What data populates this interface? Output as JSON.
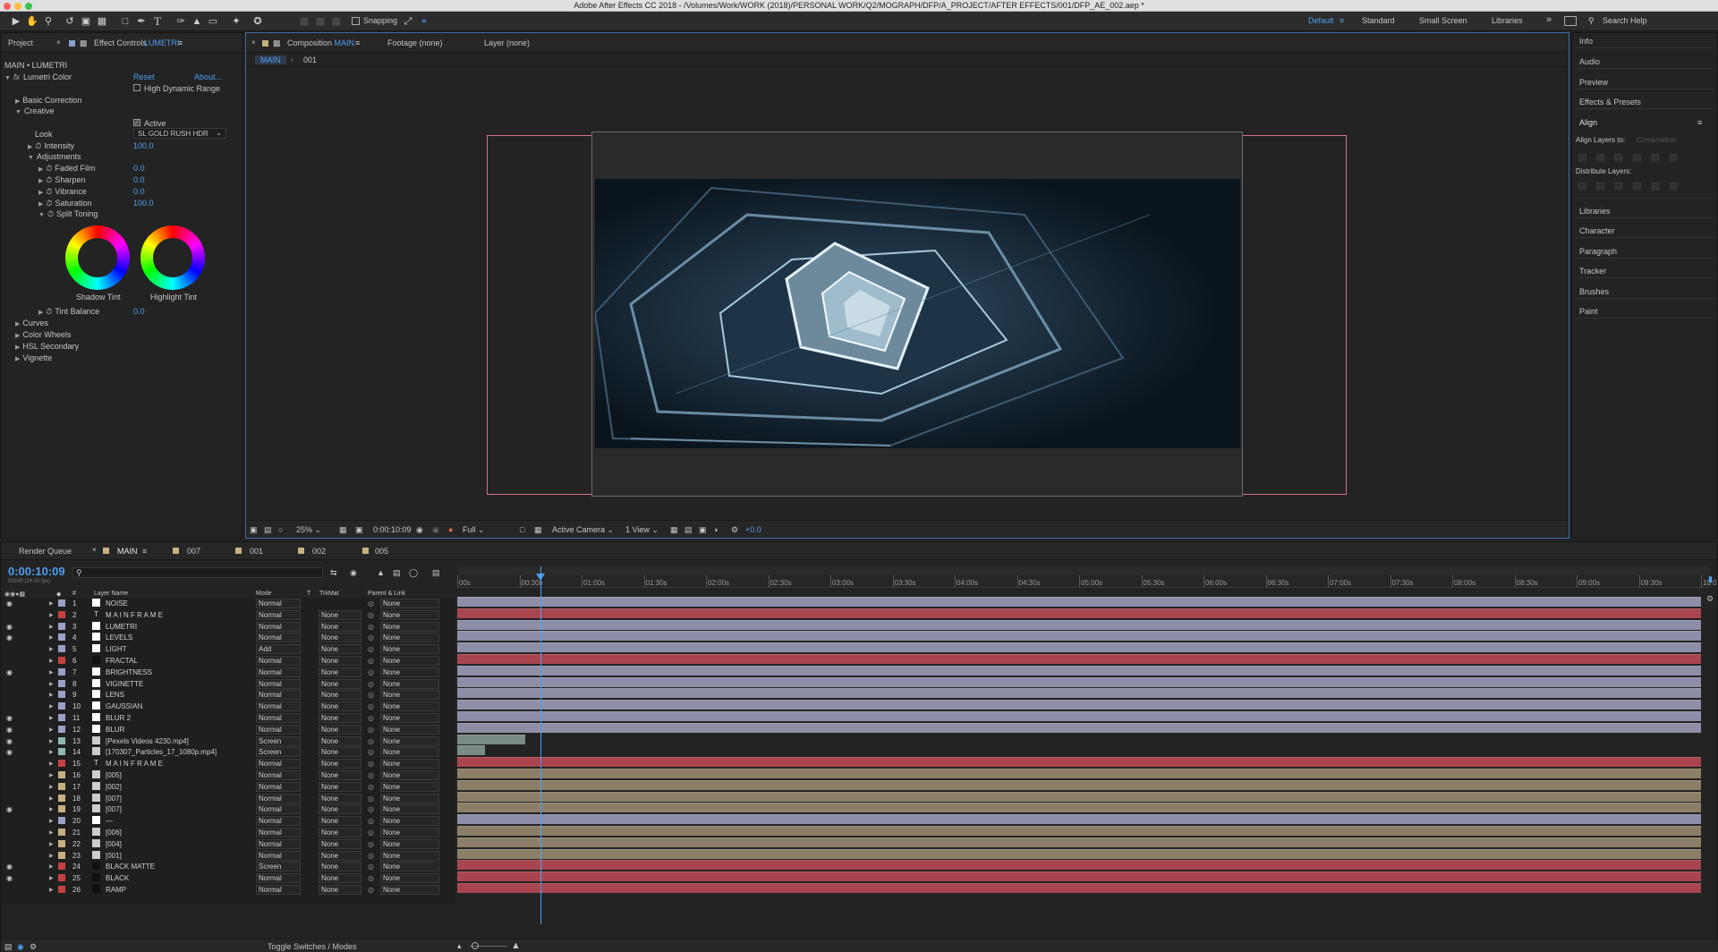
{
  "window": {
    "title": "Adobe After Effects CC 2018 - /Volumes/Work/WORK (2018)/PERSONAL WORK/Q2/MOGRAPH/DFP/A_PROJECT/AFTER EFFECTS/001/DFP_AE_002.aep *"
  },
  "toolbar": {
    "snapping": "Snapping",
    "workspaces": [
      "Default",
      "Standard",
      "Small Screen",
      "Libraries"
    ],
    "active_workspace": "Default",
    "search": "Search Help"
  },
  "left_panel": {
    "tabs": {
      "project": "Project",
      "effect_controls": "Effect Controls",
      "effect_layer": "LUMETRI"
    },
    "breadcrumb": "MAIN • LUMETRI",
    "effect": {
      "prefix": "fx",
      "name": "Lumetri Color",
      "reset": "Reset",
      "about": "About..."
    },
    "hdr": "High Dynamic Range",
    "basic": "Basic Correction",
    "creative": "Creative",
    "active": "Active",
    "look_label": "Look",
    "look_value": "SL GOLD RUSH HDR",
    "intensity": {
      "label": "Intensity",
      "value": "100.0"
    },
    "adjustments": "Adjustments",
    "params": [
      {
        "label": "Faded Film",
        "value": "0.0"
      },
      {
        "label": "Sharpen",
        "value": "0.0"
      },
      {
        "label": "Vibrance",
        "value": "0.0"
      },
      {
        "label": "Saturation",
        "value": "100.0"
      }
    ],
    "split_toning": "Split Toning",
    "shadow_tint": "Shadow Tint",
    "highlight_tint": "Highlight Tint",
    "tint_balance": {
      "label": "Tint Balance",
      "value": "0.0"
    },
    "sections": [
      "Curves",
      "Color Wheels",
      "HSL Secondary",
      "Vignette"
    ]
  },
  "viewer": {
    "tabs": {
      "composition_label": "Composition",
      "composition_name": "MAIN",
      "footage": "Footage (none)",
      "layer": "Layer (none)"
    },
    "breadcrumb": [
      "MAIN",
      "001"
    ],
    "bottom": {
      "zoom": "25%",
      "timecode": "0:00:10:09",
      "resolution": "Full",
      "camera": "Active Camera",
      "views": "1 View",
      "exposure": "+0.0"
    }
  },
  "right_panel": {
    "items": [
      "Info",
      "Audio",
      "Preview",
      "Effects & Presets",
      "Align",
      "Libraries",
      "Character",
      "Paragraph",
      "Tracker",
      "Brushes",
      "Paint"
    ],
    "align_to_label": "Align Layers to:",
    "align_to_value": "Composition",
    "distribute_label": "Distribute Layers:"
  },
  "timeline": {
    "tabs": [
      "Render Queue",
      "MAIN",
      "007",
      "001",
      "002",
      "005"
    ],
    "active_tab": "MAIN",
    "timecode": "0:00:10:09",
    "timecode_sub": "00249 (24.00 fps)",
    "columns": {
      "num": "#",
      "name": "Layer Name",
      "mode": "Mode",
      "t": "T",
      "trkmat": "TrkMat",
      "parent": "Parent & Link"
    },
    "ruler": [
      "00s",
      "00:30s",
      "01:00s",
      "01:30s",
      "02:00s",
      "02:30s",
      "03:00s",
      "03:30s",
      "04:00s",
      "04:30s",
      "05:00s",
      "05:30s",
      "06:00s",
      "06:30s",
      "07:00s",
      "07:30s",
      "08:00s",
      "08:30s",
      "09:00s",
      "09:30s",
      "10:0"
    ],
    "playhead_seconds": 0.5,
    "toggle": "Toggle Switches / Modes",
    "layers": [
      {
        "num": "1",
        "name": "NOISE",
        "mode": "Normal",
        "trkmat": "",
        "parent": "None",
        "label": "#9aa0c8",
        "bar": "#8e8ea8",
        "vis": true,
        "type": "solid",
        "start": 0,
        "end": 1
      },
      {
        "num": "2",
        "name": "M A I N F R A M E",
        "mode": "Normal",
        "trkmat": "None",
        "parent": "None",
        "label": "#c64040",
        "bar": "#a8454f",
        "vis": false,
        "type": "text",
        "start": 0,
        "end": 1
      },
      {
        "num": "3",
        "name": "LUMETRI",
        "mode": "Normal",
        "trkmat": "None",
        "parent": "None",
        "label": "#9aa0c8",
        "bar": "#8e8ea8",
        "vis": true,
        "type": "solid",
        "start": 0,
        "end": 1
      },
      {
        "num": "4",
        "name": "LEVELS",
        "mode": "Normal",
        "trkmat": "None",
        "parent": "None",
        "label": "#9aa0c8",
        "bar": "#8e8ea8",
        "vis": true,
        "type": "solid",
        "start": 0,
        "end": 1
      },
      {
        "num": "5",
        "name": "LIGHT",
        "mode": "Add",
        "trkmat": "None",
        "parent": "None",
        "label": "#9aa0c8",
        "bar": "#8e8ea8",
        "vis": false,
        "type": "solid",
        "start": 0,
        "end": 1
      },
      {
        "num": "6",
        "name": "FRACTAL",
        "mode": "Normal",
        "trkmat": "None",
        "parent": "None",
        "label": "#c64040",
        "bar": "#a8454f",
        "vis": false,
        "type": "dark",
        "start": 0,
        "end": 1
      },
      {
        "num": "7",
        "name": "BRIGHTNESS",
        "mode": "Normal",
        "trkmat": "None",
        "parent": "None",
        "label": "#9aa0c8",
        "bar": "#8e8ea8",
        "vis": true,
        "type": "solid",
        "start": 0,
        "end": 1
      },
      {
        "num": "8",
        "name": "VIGINETTE",
        "mode": "Normal",
        "trkmat": "None",
        "parent": "None",
        "label": "#9aa0c8",
        "bar": "#8e8ea8",
        "vis": false,
        "type": "solid",
        "start": 0,
        "end": 1
      },
      {
        "num": "9",
        "name": "LENS",
        "mode": "Normal",
        "trkmat": "None",
        "parent": "None",
        "label": "#9aa0c8",
        "bar": "#8e8ea8",
        "vis": false,
        "type": "solid",
        "start": 0,
        "end": 1
      },
      {
        "num": "10",
        "name": "GAUSSIAN",
        "mode": "Normal",
        "trkmat": "None",
        "parent": "None",
        "label": "#9aa0c8",
        "bar": "#8e8ea8",
        "vis": false,
        "type": "solid",
        "start": 0,
        "end": 1
      },
      {
        "num": "11",
        "name": "BLUR 2",
        "mode": "Normal",
        "trkmat": "None",
        "parent": "None",
        "label": "#9aa0c8",
        "bar": "#8e8ea8",
        "vis": true,
        "type": "solid",
        "start": 0,
        "end": 1
      },
      {
        "num": "12",
        "name": "BLUR",
        "mode": "Normal",
        "trkmat": "None",
        "parent": "None",
        "label": "#9aa0c8",
        "bar": "#8e8ea8",
        "vis": true,
        "type": "solid",
        "start": 0,
        "end": 1
      },
      {
        "num": "13",
        "name": "[Pexels Videos 4230.mp4]",
        "mode": "Screen",
        "trkmat": "None",
        "parent": "None",
        "label": "#8fb8b0",
        "bar": "#7a8a86",
        "vis": true,
        "type": "footage",
        "start": 0,
        "end": 0.055
      },
      {
        "num": "14",
        "name": "[170307_Particles_17_1080p.mp4]",
        "mode": "Screen",
        "trkmat": "None",
        "parent": "None",
        "label": "#8fb8b0",
        "bar": "#7a8a86",
        "vis": true,
        "type": "footage",
        "start": 0,
        "end": 0.022
      },
      {
        "num": "15",
        "name": "M A I N F R A M E",
        "mode": "Normal",
        "trkmat": "None",
        "parent": "None",
        "label": "#c64040",
        "bar": "#a8454f",
        "vis": false,
        "type": "text",
        "start": 0,
        "end": 1
      },
      {
        "num": "16",
        "name": "[005]",
        "mode": "Normal",
        "trkmat": "None",
        "parent": "None",
        "label": "#c8b080",
        "bar": "#8c7f68",
        "vis": false,
        "type": "comp",
        "start": 0,
        "end": 1
      },
      {
        "num": "17",
        "name": "[002]",
        "mode": "Normal",
        "trkmat": "None",
        "parent": "None",
        "label": "#c8b080",
        "bar": "#8c7f68",
        "vis": false,
        "type": "comp",
        "start": 0,
        "end": 1
      },
      {
        "num": "18",
        "name": "[007]",
        "mode": "Normal",
        "trkmat": "None",
        "parent": "None",
        "label": "#c8b080",
        "bar": "#8c7f68",
        "vis": false,
        "type": "comp",
        "start": 0,
        "end": 1
      },
      {
        "num": "19",
        "name": "[007]",
        "mode": "Normal",
        "trkmat": "None",
        "parent": "None",
        "label": "#c8b080",
        "bar": "#8c7f68",
        "vis": true,
        "type": "comp",
        "start": 0,
        "end": 1
      },
      {
        "num": "20",
        "name": "—",
        "mode": "Normal",
        "trkmat": "None",
        "parent": "None",
        "label": "#9aa0c8",
        "bar": "#8e8ea8",
        "vis": false,
        "type": "solid",
        "start": 0,
        "end": 1
      },
      {
        "num": "21",
        "name": "[006]",
        "mode": "Normal",
        "trkmat": "None",
        "parent": "None",
        "label": "#c8b080",
        "bar": "#8c7f68",
        "vis": false,
        "type": "comp",
        "start": 0,
        "end": 1
      },
      {
        "num": "22",
        "name": "[004]",
        "mode": "Normal",
        "trkmat": "None",
        "parent": "None",
        "label": "#c8b080",
        "bar": "#8c7f68",
        "vis": false,
        "type": "comp",
        "start": 0,
        "end": 1
      },
      {
        "num": "23",
        "name": "[001]",
        "mode": "Normal",
        "trkmat": "None",
        "parent": "None",
        "label": "#c8b080",
        "bar": "#8c7f68",
        "vis": false,
        "type": "comp",
        "start": 0,
        "end": 1
      },
      {
        "num": "24",
        "name": "BLACK MATTE",
        "mode": "Screen",
        "trkmat": "None",
        "parent": "None",
        "label": "#c64040",
        "bar": "#a8454f",
        "vis": true,
        "type": "dark",
        "start": 0,
        "end": 1
      },
      {
        "num": "25",
        "name": "BLACK",
        "mode": "Normal",
        "trkmat": "None",
        "parent": "None",
        "label": "#c64040",
        "bar": "#a8454f",
        "vis": true,
        "type": "dark",
        "start": 0,
        "end": 1
      },
      {
        "num": "26",
        "name": "RAMP",
        "mode": "Normal",
        "trkmat": "None",
        "parent": "None",
        "label": "#c64040",
        "bar": "#a8454f",
        "vis": false,
        "type": "dark",
        "start": 0,
        "end": 1
      }
    ]
  },
  "colors": {
    "accent": "#4f9ff0",
    "bg": "#232323",
    "panel_border": "#161616",
    "comp_guide": "#e07a90"
  }
}
